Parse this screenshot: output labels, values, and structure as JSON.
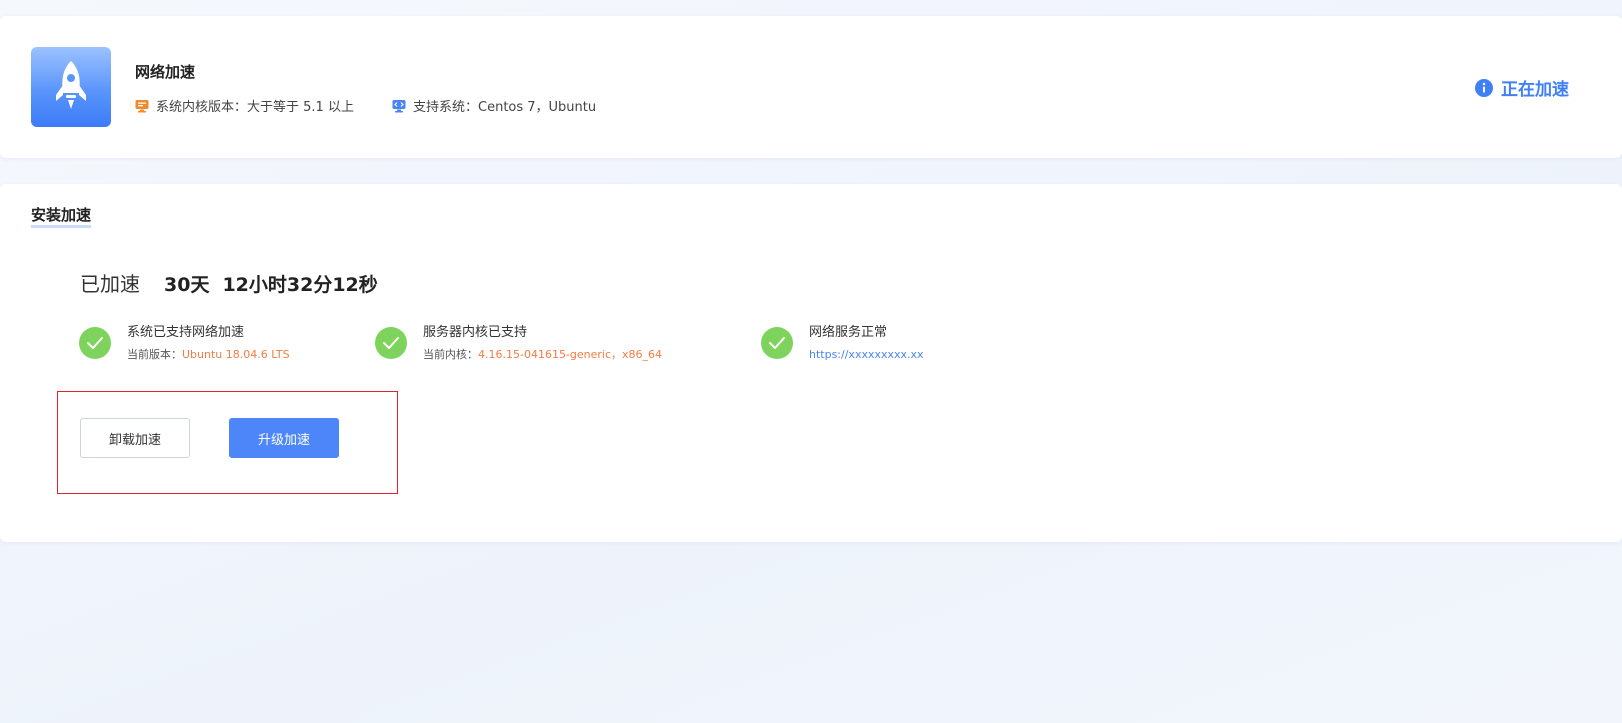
{
  "header": {
    "app_name": "网络加速",
    "logo_icon": "rocket-icon",
    "kernel_requirement": "系统内核版本：大于等于 5.1 以上",
    "supported_systems": "支持系统：Centos 7，Ubuntu",
    "status_label": "正在加速",
    "accent_color": "#3f7ff7"
  },
  "install_section": {
    "title": "安装加速",
    "accelerated_label": "已加速",
    "duration_days": "30天",
    "duration_time": "12小时32分12秒",
    "checks": [
      {
        "title": "系统已支持网络加速",
        "detail_label": "当前版本：",
        "detail_value": "Ubuntu 18.04.6 LTS",
        "icon": "check-icon"
      },
      {
        "title": "服务器内核已支持",
        "detail_label": "当前内核：",
        "detail_value": "4.16.15-041615-generic，x86_64",
        "icon": "check-icon"
      },
      {
        "title": "网络服务正常",
        "detail_value": "https://xxxxxxxxx.xx",
        "icon": "check-icon"
      }
    ],
    "buttons": {
      "uninstall": "卸载加速",
      "upgrade": "升级加速"
    }
  }
}
